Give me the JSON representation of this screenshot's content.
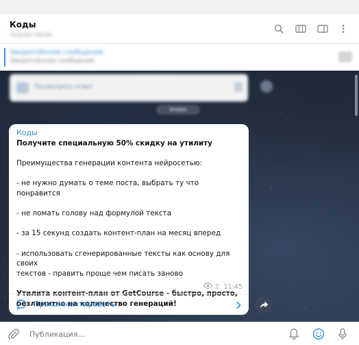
{
  "header": {
    "title": "Коды",
    "subtitle": "подписчиков"
  },
  "pinned": {
    "title": "Закреплённое сообщение",
    "text": "Закреплённое сообщение"
  },
  "blurred_card": {
    "text": "Посмотреть ответ"
  },
  "blurred_date": "вчера",
  "post": {
    "sender": "Коды",
    "headline": "Получите специальную 50% скидку на утилиту",
    "intro": "Преимущества генерации контента нейросетью:",
    "bullet1": "- не нужно думать о теме поста, выбрать ту что понравится",
    "bullet2": "- не ломать голову над формулой текста",
    "bullet3": "- за 15 секунд создать контент-план на месяц вперед",
    "bullet4a": "- использовать сгенерированные тексты как основу для своих",
    "bullet4b": "текстов - править проще чем писать заново",
    "closing1": "Утилита контент-план от GetCourse - быстро, просто,",
    "closing2": "безлимитно на количество генераций!",
    "views": "2",
    "time": "11:45",
    "comment_label": "Прокомментировать"
  },
  "composer": {
    "placeholder": "Публикация..."
  },
  "icons": {
    "header": [
      "search-icon",
      "columns-icon",
      "sidebar-icon",
      "more-icon"
    ],
    "bottom": [
      "paperclip-icon",
      "bell-icon",
      "emoji-icon",
      "microphone-icon"
    ]
  },
  "colors": {
    "accent": "#3a8fd6",
    "bubble": "#ffffff",
    "background": "#212b3b"
  }
}
